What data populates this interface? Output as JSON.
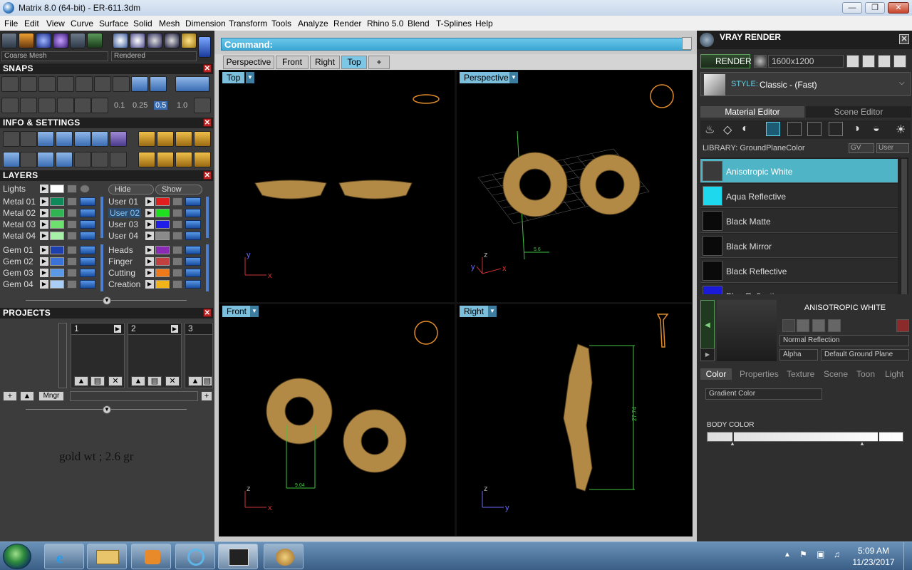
{
  "window": {
    "title": "Matrix 8.0 (64-bit) - ER-611.3dm",
    "buttons": {
      "minimize": "—",
      "maximize": "❐",
      "close": "✕"
    }
  },
  "menu": [
    "File",
    "Edit",
    "View",
    "Curve",
    "Surface",
    "Solid",
    "Mesh",
    "Dimension",
    "Transform",
    "Tools",
    "Analyze",
    "Render",
    "Rhino 5.0",
    "Blend",
    "T-Splines",
    "Help"
  ],
  "left": {
    "mesh_quality": "Coarse Mesh",
    "display_mode": "Rendered",
    "snaps_title": "SNAPS",
    "snap_values": [
      "0.1",
      "0.25",
      "0.5",
      "1.0"
    ],
    "info_title": "INFO & SETTINGS",
    "layers_title": "LAYERS",
    "lights_label": "Lights",
    "hide_label": "Hide",
    "show_label": "Show",
    "layers_left": [
      {
        "name": "Metal 01",
        "color": "#0e8a5a"
      },
      {
        "name": "Metal 02",
        "color": "#2fb552"
      },
      {
        "name": "Metal 03",
        "color": "#6ee06e"
      },
      {
        "name": "Metal 04",
        "color": "#a7f0a7"
      },
      {
        "name": "Gem 01",
        "color": "#1e3fae"
      },
      {
        "name": "Gem 02",
        "color": "#3a72d8"
      },
      {
        "name": "Gem 03",
        "color": "#5a98e8"
      },
      {
        "name": "Gem 04",
        "color": "#a9cdf4"
      }
    ],
    "layers_right": [
      {
        "name": "User 01",
        "color": "#e01e1e"
      },
      {
        "name": "User 02",
        "color": "#1ee01e"
      },
      {
        "name": "User 03",
        "color": "#1e1ee8"
      },
      {
        "name": "User 04",
        "color": "#8a8a8a"
      },
      {
        "name": "Heads",
        "color": "#8a2ab5"
      },
      {
        "name": "Finger",
        "color": "#c24040"
      },
      {
        "name": "Cutting",
        "color": "#f07a1a"
      },
      {
        "name": "Creation",
        "color": "#f0b41a"
      }
    ],
    "projects_title": "PROJECTS",
    "projects": [
      "1",
      "2",
      "3"
    ],
    "mngr_label": "Mngr",
    "note": "gold wt ; 2.6 gr"
  },
  "main": {
    "command_label": "Command:",
    "tabs": [
      "Perspective",
      "Front",
      "Right",
      "Top",
      "+"
    ],
    "active_tab": "Top",
    "viewports": [
      {
        "name": "Top",
        "ax1": "y",
        "ax2": "x"
      },
      {
        "name": "Perspective",
        "ax1": "z",
        "ax2": "x",
        "ax3": "y",
        "dim": "5.6"
      },
      {
        "name": "Front",
        "ax1": "z",
        "ax2": "x",
        "dim": "9.04"
      },
      {
        "name": "Right",
        "ax1": "z",
        "ax2": "y",
        "dim": "27.74"
      }
    ],
    "accent_color": "#7bbfdc",
    "gold_color": "#b38a45"
  },
  "right": {
    "title": "VRAY RENDER",
    "render_label": "RENDER",
    "resolution": "1600x1200",
    "style_label": "STYLE:",
    "style_value": "Classic - (Fast)",
    "tabs": [
      "Material Editor",
      "Scene Editor"
    ],
    "library_label": "LIBRARY: GroundPlaneColor",
    "gv_label": "GV",
    "user_label": "User",
    "materials": [
      {
        "name": "Anisotropic White",
        "color": "#3a3a3a",
        "selected": true
      },
      {
        "name": "Aqua Reflective",
        "color": "#1ed8ee",
        "selected": false
      },
      {
        "name": "Black Matte",
        "color": "#0a0a0a",
        "selected": false
      },
      {
        "name": "Black Mirror",
        "color": "#0a0a0a",
        "selected": false
      },
      {
        "name": "Black Reflective",
        "color": "#0a0a0a",
        "selected": false
      },
      {
        "name": "Blue Reflective",
        "color": "#1a1ad8",
        "selected": false
      }
    ],
    "preview_title": "ANISOTROPIC WHITE",
    "reflection_mode": "Normal Reflection",
    "alpha_label": "Alpha",
    "ground_plane": "Default Ground Plane",
    "subtabs": [
      "Color",
      "Properties",
      "Texture",
      "Scene",
      "Toon",
      "Light"
    ],
    "color_mode": "Gradient Color",
    "body_color_label": "BODY COLOR"
  },
  "taskbar": {
    "time": "5:09 AM",
    "date": "11/23/2017"
  }
}
